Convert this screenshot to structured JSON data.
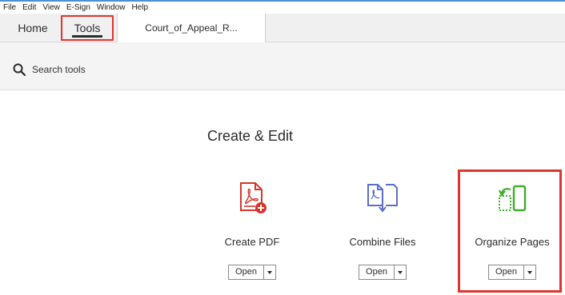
{
  "menu": [
    "File",
    "Edit",
    "View",
    "E-Sign",
    "Window",
    "Help"
  ],
  "tabs": {
    "home": "Home",
    "tools": "Tools",
    "document": "Court_of_Appeal_R..."
  },
  "search": {
    "placeholder": "Search tools"
  },
  "section": {
    "title": "Create & Edit"
  },
  "tools": [
    {
      "label": "Create PDF",
      "open": "Open",
      "icon": "create-pdf-icon",
      "color": "#d9342b"
    },
    {
      "label": "Combine Files",
      "open": "Open",
      "icon": "combine-files-icon",
      "color": "#5a6fc9"
    },
    {
      "label": "Organize Pages",
      "open": "Open",
      "icon": "organize-pages-icon",
      "color": "#3fae2a"
    }
  ],
  "colors": {
    "highlight": "#e0342f",
    "accent": "#4a90d9"
  }
}
